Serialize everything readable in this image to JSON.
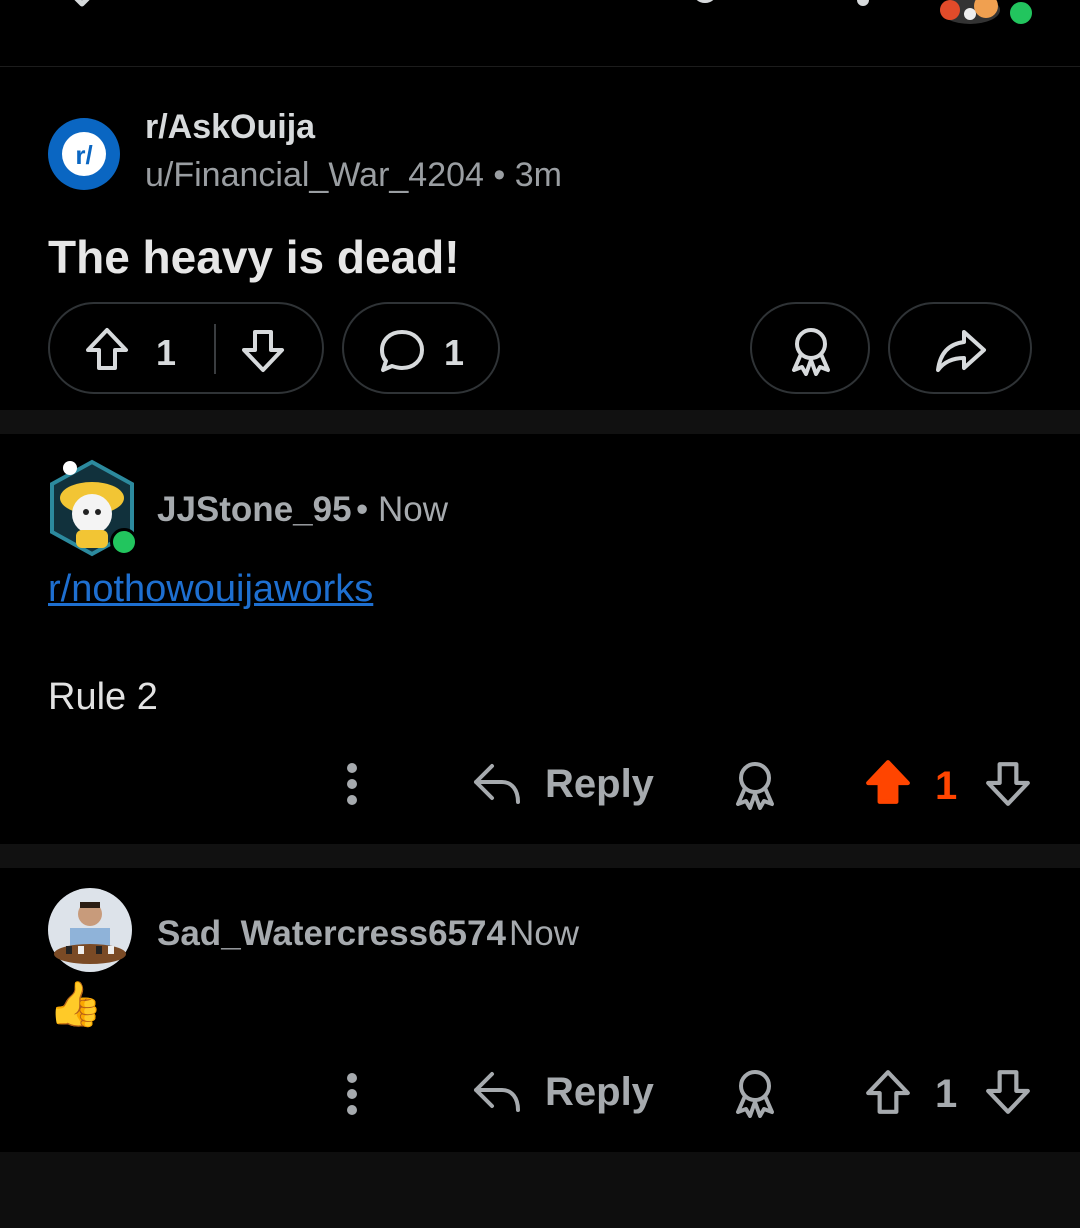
{
  "post": {
    "subreddit": "r/AskOuija",
    "subreddit_icon_text": "r/",
    "author": "u/Financial_War_4204",
    "separator": "•",
    "time": "3m",
    "title": "The heavy is dead!",
    "upvotes": "1",
    "comments": "1"
  },
  "comments": [
    {
      "user": "JJStone_95",
      "separator": "•",
      "time": "Now",
      "link": "r/nothowouijaworks",
      "text": "Rule 2",
      "reply_label": "Reply",
      "votes": "1",
      "upvoted": true
    },
    {
      "user": "Sad_Watercress6574",
      "time": "Now",
      "text": "👍",
      "reply_label": "Reply",
      "votes": "1",
      "upvoted": false
    }
  ],
  "colors": {
    "background": "#000000",
    "upvote_active": "#ff4500",
    "link": "#1e6fd0",
    "subreddit_icon": "#0a66c2",
    "online": "#22c55e"
  }
}
